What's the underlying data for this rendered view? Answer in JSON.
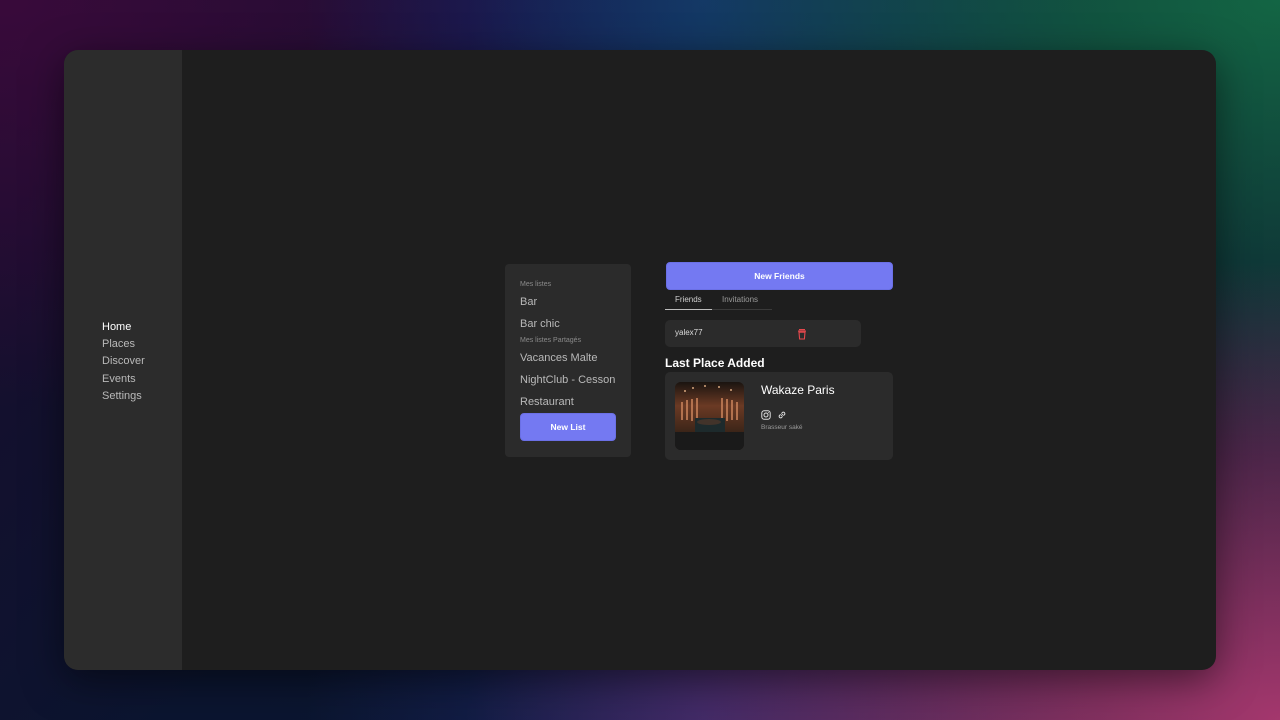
{
  "nav": {
    "items": [
      {
        "label": "Home",
        "active": true
      },
      {
        "label": "Places",
        "active": false
      },
      {
        "label": "Discover",
        "active": false
      },
      {
        "label": "Events",
        "active": false
      },
      {
        "label": "Settings",
        "active": false
      }
    ]
  },
  "lists": {
    "my_lists_label": "Mes listes",
    "my_lists": [
      "Bar",
      "Bar chic"
    ],
    "shared_lists_label": "Mes listes Partagés",
    "shared_lists": [
      "Vacances Malte",
      "NightClub - Cesson",
      "Restaurant"
    ],
    "new_list_button": "New List"
  },
  "friends": {
    "new_friends_button": "New Friends",
    "tabs": [
      {
        "label": "Friends",
        "active": true
      },
      {
        "label": "Invitations",
        "active": false
      }
    ],
    "items": [
      {
        "name": "yalex77",
        "action_icon": "trash-icon"
      }
    ]
  },
  "last_place": {
    "title": "Last Place Added",
    "name": "Wakaze Paris",
    "icons": [
      "instagram-icon",
      "link-icon"
    ],
    "category": "Brasseur saké"
  },
  "colors": {
    "accent": "#7479f2",
    "danger": "#e5484d",
    "window_bg": "#1e1e1e",
    "card_bg": "#2b2b2b"
  }
}
